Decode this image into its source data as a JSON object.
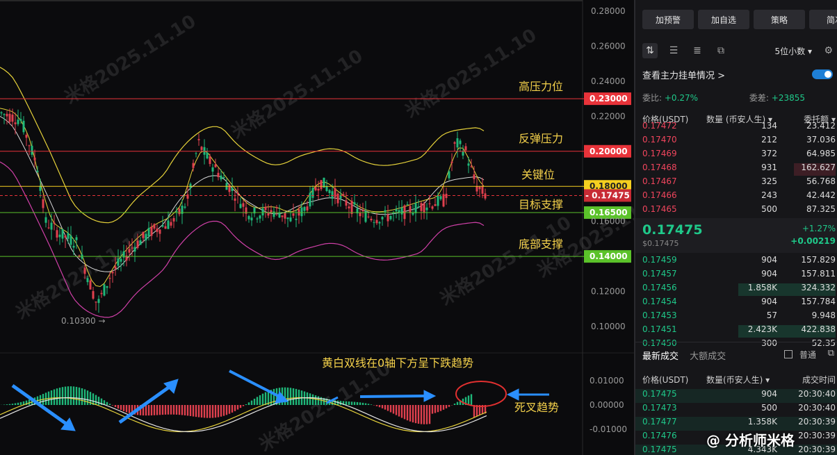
{
  "price_axis": [
    "0.28000",
    "0.26000",
    "0.24000",
    "0.22000",
    "0.12000",
    "0.10000"
  ],
  "price_axis_hidden": [
    "0.16000"
  ],
  "macd_axis": [
    "0.01000",
    "0.00000",
    "-0.01000"
  ],
  "levels": [
    {
      "label": "高压力位",
      "price": "0.23000",
      "color": "#e8333a",
      "line": "#e8333a"
    },
    {
      "label": "反弹压力",
      "price": "0.20000",
      "color": "#e8333a",
      "line": "#e8333a"
    },
    {
      "label": "关键位",
      "price": "0.18000",
      "color": "#f5d020",
      "line": "#f5d020"
    },
    {
      "label": "目标支撑",
      "price": "0.16500",
      "color": "#5bc22a",
      "line": "#5bc22a"
    },
    {
      "label": "底部支撑",
      "price": "0.14000",
      "color": "#5bc22a",
      "line": "#5bc22a"
    }
  ],
  "current_price_tag": "0.17475",
  "low_marker": "0.10300 →",
  "macd_annotation": "黄白双线在0轴下方呈下跌趋势",
  "death_cross": "死叉趋势",
  "watermark": "米格2025.11.10",
  "brand": "@ 分析师米格",
  "sidebar": {
    "buttons": [
      "加预警",
      "加自选",
      "策略",
      "简况"
    ],
    "decimals": "5位小数 ▾",
    "main_orders": "查看主力挂单情况 >",
    "ratio_label": "委比:",
    "ratio_value": "+0.27%",
    "diff_label": "委差:",
    "diff_value": "+23855",
    "headers": {
      "price": "价格(USDT)",
      "qty": "数量 (币安人生) ▾",
      "amount": "委托额 ▾"
    },
    "asks": [
      {
        "p": "0.17472",
        "q": "134",
        "a": "23.412"
      },
      {
        "p": "0.17470",
        "q": "212",
        "a": "37.036"
      },
      {
        "p": "0.17469",
        "q": "372",
        "a": "64.985"
      },
      {
        "p": "0.17468",
        "q": "931",
        "a": "162.627"
      },
      {
        "p": "0.17467",
        "q": "325",
        "a": "56.768"
      },
      {
        "p": "0.17466",
        "q": "243",
        "a": "42.442"
      },
      {
        "p": "0.17465",
        "q": "500",
        "a": "87.325"
      }
    ],
    "mid_price": "0.17475",
    "mid_sub": "$0.17475",
    "mid_change_pct": "+1.27%",
    "mid_change": "+0.00219",
    "bids": [
      {
        "p": "0.17459",
        "q": "904",
        "a": "157.829"
      },
      {
        "p": "0.17457",
        "q": "904",
        "a": "157.811"
      },
      {
        "p": "0.17456",
        "q": "1.858K",
        "a": "324.332"
      },
      {
        "p": "0.17454",
        "q": "904",
        "a": "157.784"
      },
      {
        "p": "0.17453",
        "q": "57",
        "a": "9.948"
      },
      {
        "p": "0.17451",
        "q": "2.423K",
        "a": "422.838"
      },
      {
        "p": "0.17450",
        "q": "300",
        "a": "52.35"
      }
    ],
    "tab_latest": "最新成交",
    "tab_large": "大额成交",
    "normal": "普通",
    "trade_headers": {
      "price": "价格(USDT)",
      "qty": "数量(币安人生) ▾",
      "time": "成交时间"
    },
    "trades": [
      {
        "p": "0.17475",
        "q": "904",
        "t": "20:30:40"
      },
      {
        "p": "0.17473",
        "q": "500",
        "t": "20:30:40"
      },
      {
        "p": "0.17477",
        "q": "1.358K",
        "t": "20:30:39"
      },
      {
        "p": "0.17476",
        "q": "",
        "t": "20:30:39"
      },
      {
        "p": "0.17475",
        "q": "4.343K",
        "t": "20:30:39"
      }
    ]
  }
}
